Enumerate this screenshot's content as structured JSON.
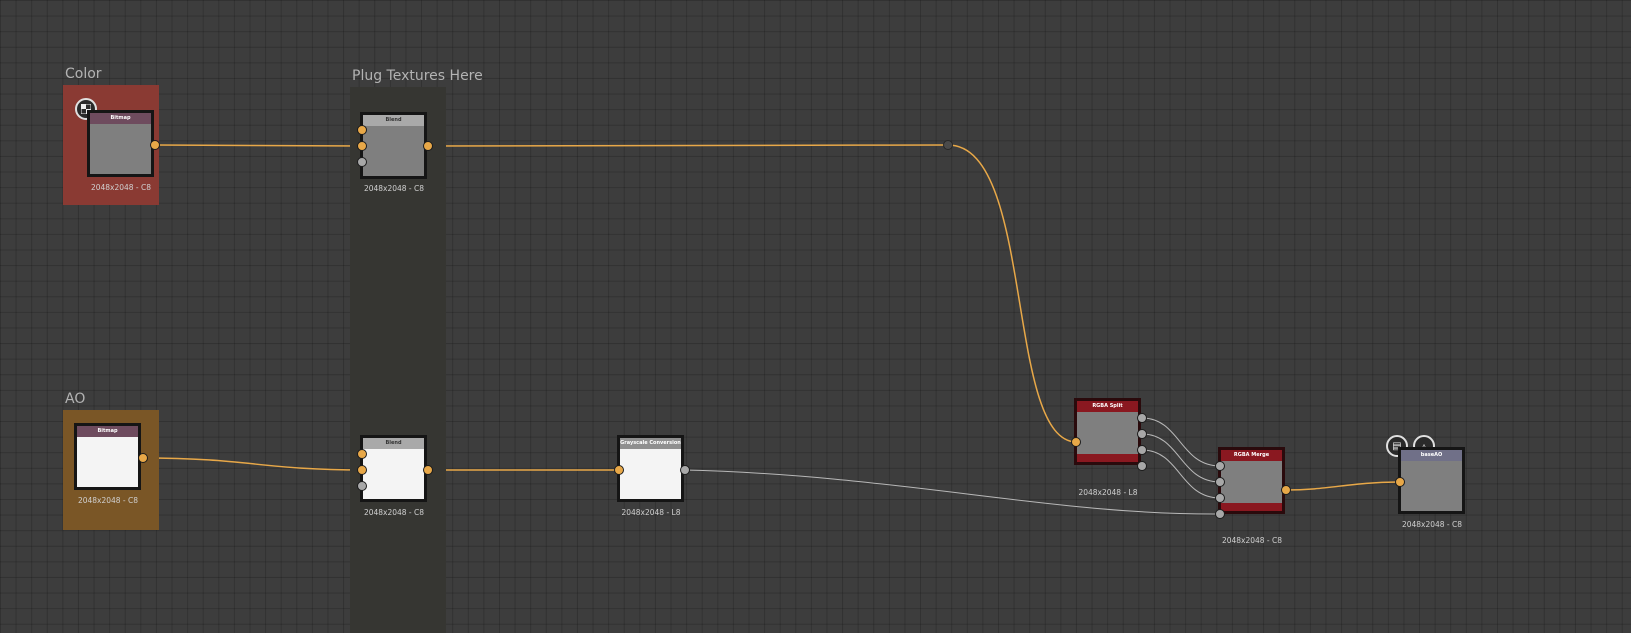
{
  "frames": {
    "color": {
      "title": "Color",
      "color": "#8a3a33"
    },
    "plug": {
      "title": "Plug Textures Here",
      "color": "#363632"
    },
    "ao": {
      "title": "AO",
      "color": "#7a5626"
    }
  },
  "nodes": {
    "bitmap_color": {
      "title": "Bitmap",
      "resolution": "2048x2048 - C8",
      "header_color": "#6e4b5e"
    },
    "bitmap_ao": {
      "title": "Bitmap",
      "resolution": "2048x2048 - C8",
      "header_color": "#6e4b5e"
    },
    "blend_top": {
      "title": "Blend",
      "resolution": "2048x2048 - C8",
      "header_color": "#a9a9a9"
    },
    "blend_bottom": {
      "title": "Blend",
      "resolution": "2048x2048 - C8",
      "header_color": "#a9a9a9"
    },
    "grayscale": {
      "title": "Grayscale Conversion",
      "resolution": "2048x2048 - L8",
      "header_color": "#8f8f8f"
    },
    "rgba_split": {
      "title": "RGBA Split",
      "resolution": "2048x2048 - L8",
      "header_color": "#8a1820"
    },
    "rgba_merge": {
      "title": "RGBA Merge",
      "resolution": "2048x2048 - C8",
      "header_color": "#8a1820"
    },
    "output": {
      "title": "baseAO",
      "resolution": "2048x2048 - C8",
      "header_color": "#707088"
    }
  },
  "icons": {
    "bitmap": "checker-icon",
    "output_doc": "document-icon",
    "output_cube": "cube-icon"
  },
  "colors": {
    "wire_orange": "#e8a848",
    "wire_gray": "#b8b8b8",
    "background": "#3d3d3d"
  }
}
